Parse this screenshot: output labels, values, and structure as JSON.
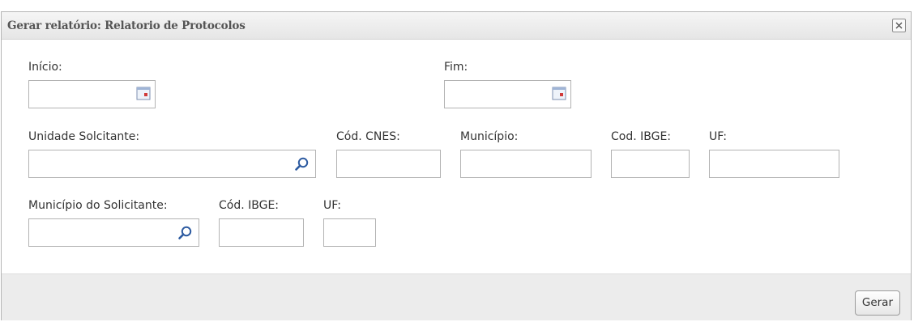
{
  "dialog": {
    "title": "Gerar relatório: Relatorio de Protocolos"
  },
  "form": {
    "inicio_label": "Início:",
    "fim_label": "Fim:",
    "unidade_label": "Unidade Solcitante:",
    "cnes_label": "Cód. CNES:",
    "municipio_label": "Município:",
    "ibge_label": "Cod. IBGE:",
    "uf_label": "UF:",
    "municipio_solicitante_label": "Município do Solicitante:",
    "ibge2_label": "Cód. IBGE:",
    "uf2_label": "UF:"
  },
  "icons": {
    "calendar": "calendar-icon",
    "search": "search-icon",
    "close": "close-icon"
  },
  "footer": {
    "gerar_label": "Gerar"
  }
}
